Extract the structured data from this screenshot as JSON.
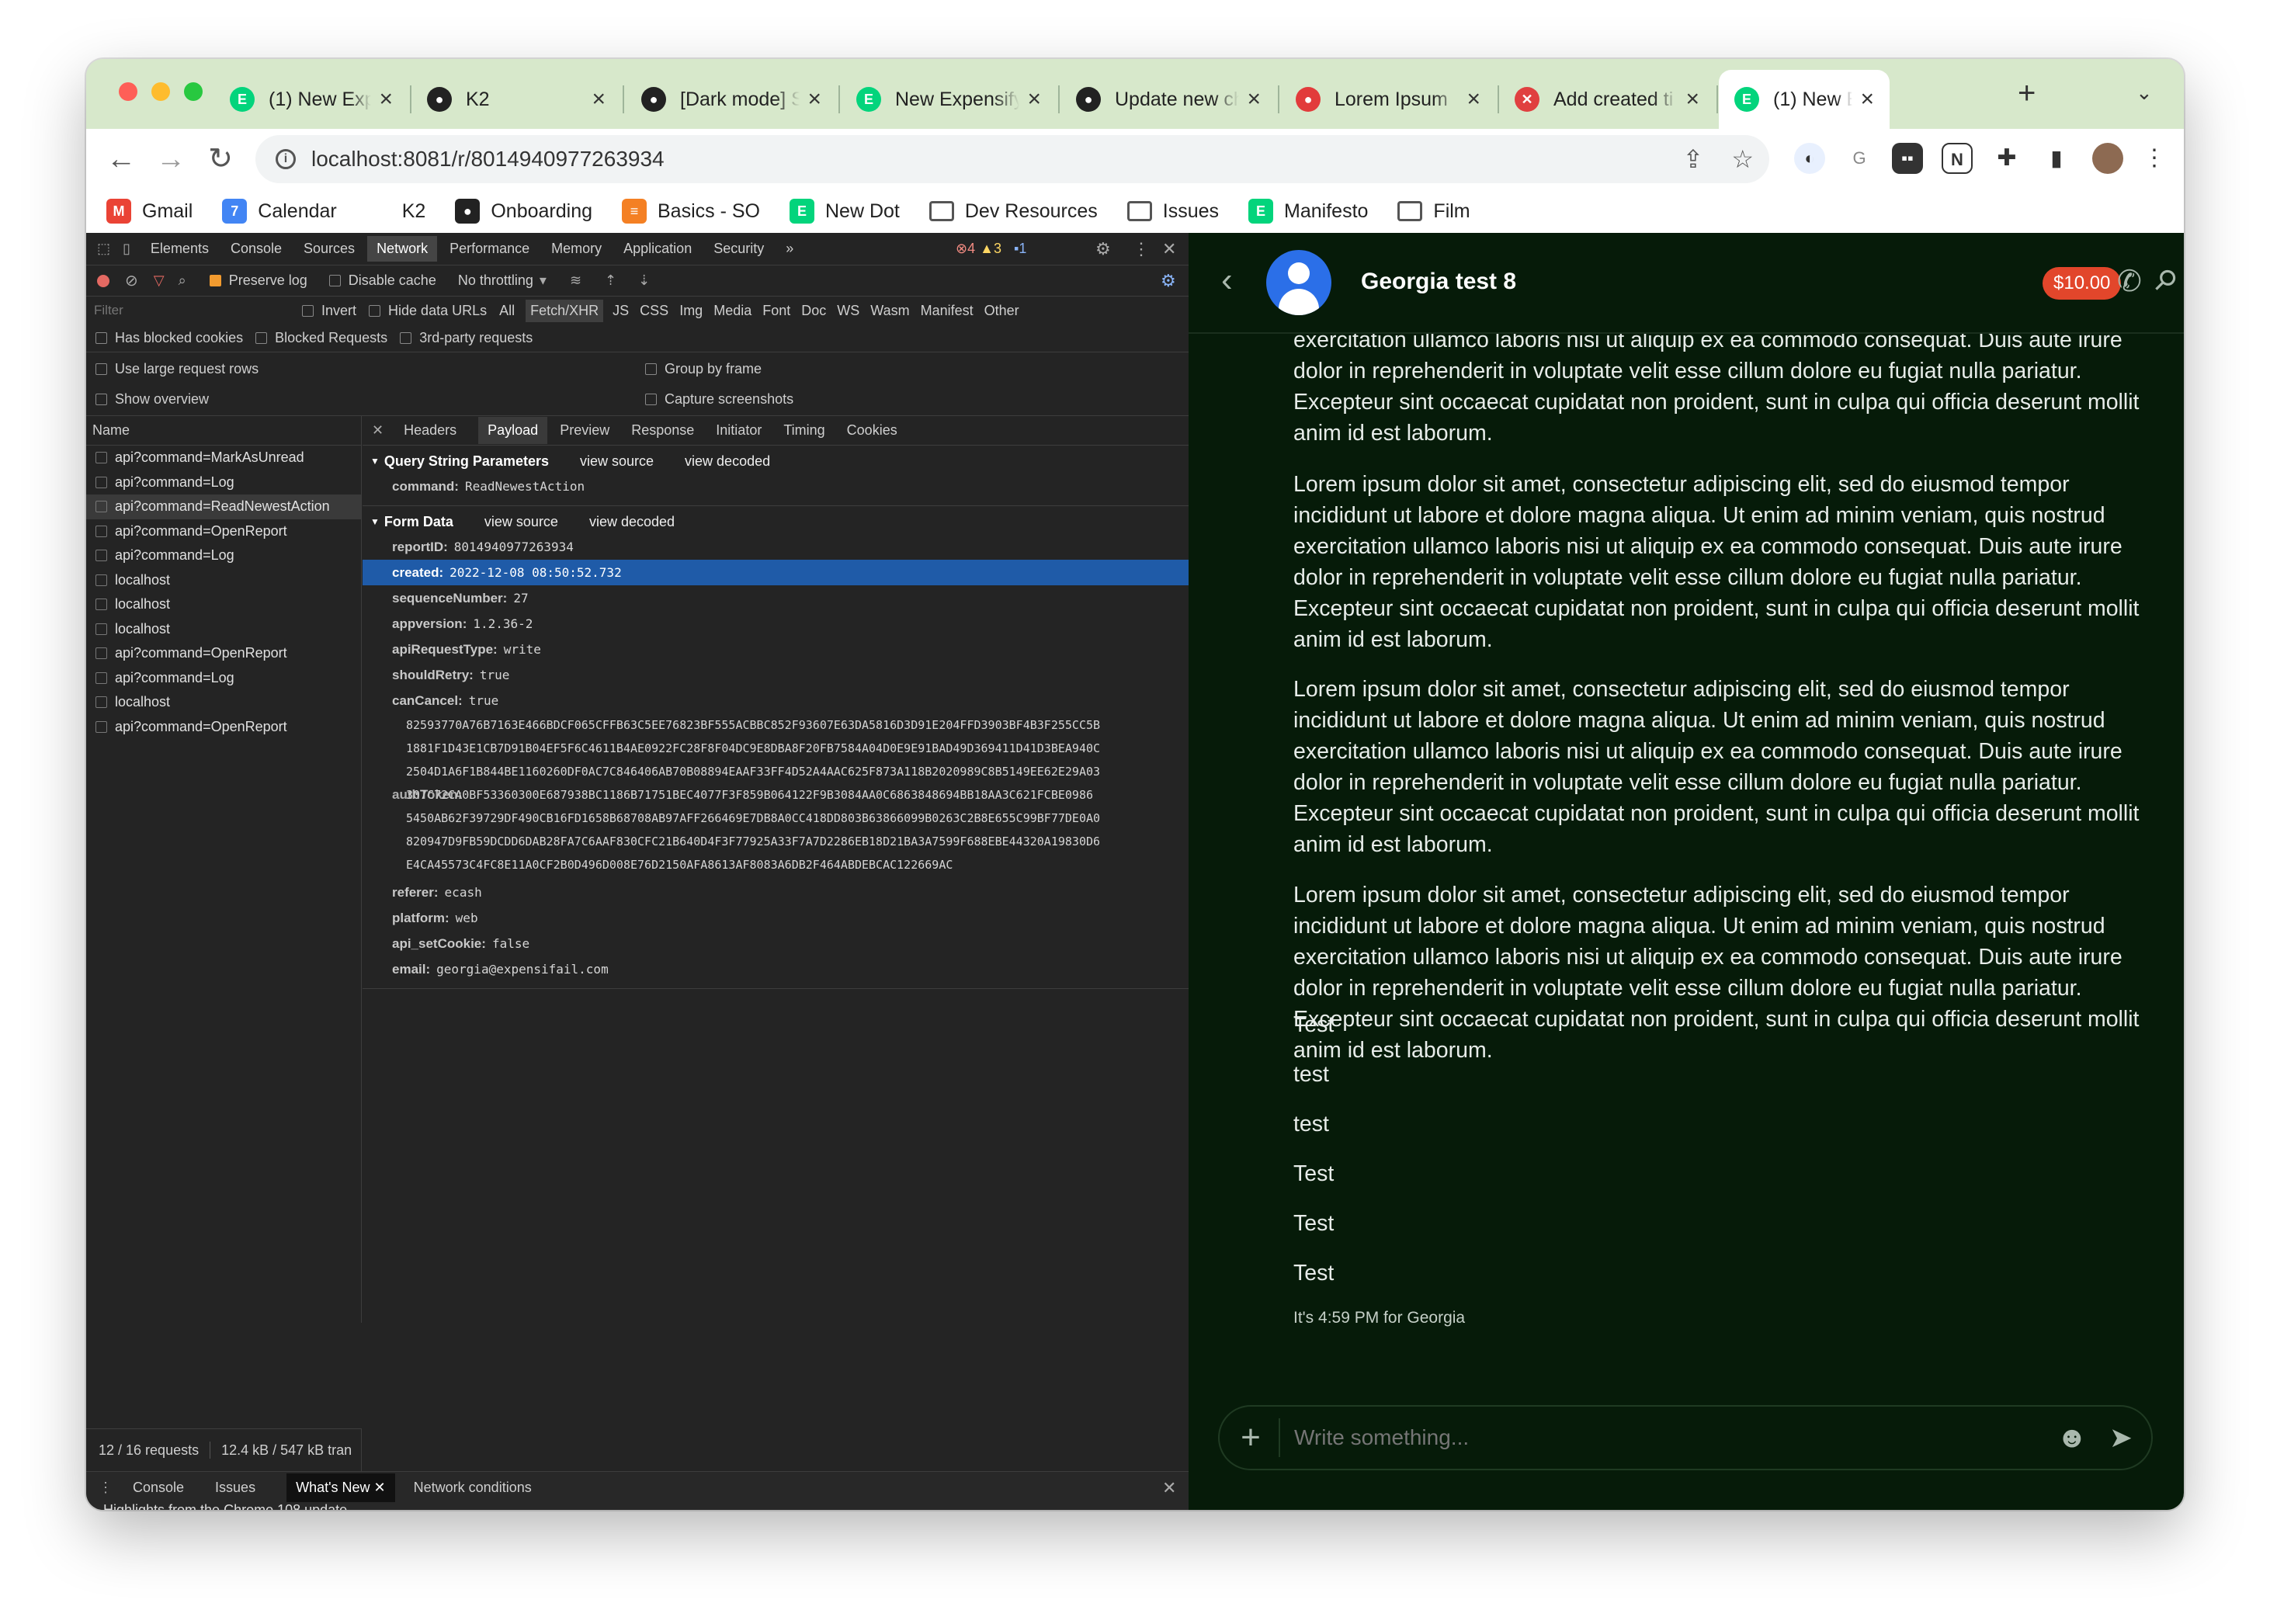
{
  "browser": {
    "tabs": [
      {
        "label": "(1) New Expensify",
        "icon": "expensify-icon",
        "color": "#03d47c"
      },
      {
        "label": "K2",
        "icon": "github-icon",
        "color": "#222222"
      },
      {
        "label": "[Dark mode] Se",
        "icon": "github-icon",
        "color": "#222222"
      },
      {
        "label": "New Expensify",
        "icon": "expensify-icon",
        "color": "#03d47c"
      },
      {
        "label": "Update new ch",
        "icon": "github-icon",
        "color": "#222222"
      },
      {
        "label": "Lorem Ipsum",
        "icon": "lorem-icon",
        "color": "#e23b3b"
      },
      {
        "label": "Add created ti",
        "icon": "error-icon",
        "color": "#e04040"
      },
      {
        "label": "(1) New Expensify",
        "icon": "expensify-icon",
        "color": "#03d47c"
      }
    ],
    "new_tab": "+",
    "url": "localhost:8081/r/8014940977263934",
    "bookmarks": [
      {
        "label": "Gmail",
        "icon": "gmail-icon"
      },
      {
        "label": "Calendar",
        "icon": "calendar-icon"
      },
      {
        "label": "K2",
        "icon": "blank-icon"
      },
      {
        "label": "Onboarding",
        "icon": "github-icon"
      },
      {
        "label": "Basics - SO",
        "icon": "stackoverflow-icon"
      },
      {
        "label": "New Dot",
        "icon": "expensify-icon"
      },
      {
        "label": "Dev Resources",
        "icon": "folder-icon"
      },
      {
        "label": "Issues",
        "icon": "folder-icon"
      },
      {
        "label": "Manifesto",
        "icon": "expensify-icon"
      },
      {
        "label": "Film",
        "icon": "folder-icon"
      }
    ]
  },
  "devtools": {
    "tabs": [
      "Elements",
      "Console",
      "Sources",
      "Network",
      "Performance",
      "Memory",
      "Application",
      "Security",
      "»"
    ],
    "active_tab": "Network",
    "badges": {
      "errors": "4",
      "warnings": "3",
      "messages": "1"
    },
    "toolbar": {
      "preserve_log": "Preserve log",
      "disable_cache": "Disable cache",
      "throttling": "No throttling"
    },
    "filter": {
      "placeholder": "Filter",
      "invert": "Invert",
      "hide_data_urls": "Hide data URLs",
      "types": [
        "All",
        "Fetch/XHR",
        "JS",
        "CSS",
        "Img",
        "Media",
        "Font",
        "Doc",
        "WS",
        "Wasm",
        "Manifest",
        "Other"
      ]
    },
    "options": {
      "blocked_cookies": "Has blocked cookies",
      "blocked_requests": "Blocked Requests",
      "third_party": "3rd-party requests",
      "large_rows": "Use large request rows",
      "group_by_frame": "Group by frame",
      "show_overview": "Show overview",
      "capture_screenshots": "Capture screenshots"
    },
    "name_header": "Name",
    "requests": [
      "api?command=MarkAsUnread",
      "api?command=Log",
      "api?command=ReadNewestAction",
      "api?command=OpenReport",
      "api?command=Log",
      "localhost",
      "localhost",
      "localhost",
      "api?command=OpenReport",
      "api?command=Log",
      "localhost",
      "api?command=OpenReport"
    ],
    "status_bar": {
      "requests": "12 / 16 requests",
      "transferred": "12.4 kB / 547 kB tran"
    },
    "payload_tabs": [
      "Headers",
      "Payload",
      "Preview",
      "Response",
      "Initiator",
      "Timing",
      "Cookies"
    ],
    "query_title": "Query String Parameters",
    "view_source": "view source",
    "view_decoded": "view decoded",
    "query_params": [
      {
        "k": "command:",
        "v": "ReadNewestAction"
      }
    ],
    "form_title": "Form Data",
    "form_data": [
      {
        "k": "reportID:",
        "v": "8014940977263934"
      },
      {
        "k": "created:",
        "v": "2022-12-08 08:50:52.732"
      },
      {
        "k": "sequenceNumber:",
        "v": "27"
      },
      {
        "k": "appversion:",
        "v": "1.2.36-2"
      },
      {
        "k": "apiRequestType:",
        "v": "write"
      },
      {
        "k": "shouldRetry:",
        "v": "true"
      },
      {
        "k": "canCancel:",
        "v": "true"
      }
    ],
    "auth_key": "authToken:",
    "hex_lines": [
      "82593770A76B7163E466BDCF065CFFB63C5EE76823BF555ACBBC852F93607E63DA5816D3D91E204FFD3903BF4B3F255CC5B",
      "1881F1D43E1CB7D91B04EF5F6C4611B4AE0922FC28F8F04DC9E8DBA8F20FB7584A04D0E9E91BAD49D369411D41D3BEA940C",
      "2504D1A6F1B844BE1160260DF0AC7C846406AB70B08894EAAF33FF4D52A4AAC625F873A118B2020989C8B5149EE62E29A03",
      "307C72CA0BF53360300E687938BC1186B71751BEC4077F3F859B064122F9B3084AA0C6863848694BB18AA3C621FCBE0986",
      "5450AB62F39729DF490CB16FD1658B68708AB97AFF266469E7DB8A0CC418DD803B63866099B0263C2B8E655C99BF77DE0A0",
      "820947D9FB59DCDD6DAB28FA7C6AAF830CFC21B640D4F3F77925A33F7A7D2286EB18D21BA3A7599F688EBE44320A19830D6",
      "E4CA45573C4FC8E11A0CF2B0D496D008E76D2150AFA8613AF8083A6DB2F464ABDEBCAC122669AC"
    ],
    "form_data_tail": [
      {
        "k": "referer:",
        "v": "ecash"
      },
      {
        "k": "platform:",
        "v": "web"
      },
      {
        "k": "api_setCookie:",
        "v": "false"
      },
      {
        "k": "email:",
        "v": "georgia@expensifail.com"
      }
    ],
    "drawer_tabs": [
      "Console",
      "Issues",
      "What's New",
      "Network conditions"
    ],
    "drawer_peek": "Highlights from the Chrome 108 update"
  },
  "chat": {
    "title": "Georgia test 8",
    "badge": "$10.00",
    "partial_message": "exercitation ullamco laboris nisi ut aliquip ex ea commodo consequat. Duis aute irure dolor in reprehenderit in voluptate velit esse cillum dolore eu fugiat nulla pariatur. Excepteur sint occaecat cupidatat non proident, sunt in culpa qui officia deserunt mollit anim id est laborum.",
    "lorem": "Lorem ipsum dolor sit amet, consectetur adipiscing elit, sed do eiusmod tempor incididunt ut labore et dolore magna aliqua. Ut enim ad minim veniam, quis nostrud exercitation ullamco laboris nisi ut aliquip ex ea commodo consequat. Duis aute irure dolor in reprehenderit in voluptate velit esse cillum dolore eu fugiat nulla pariatur. Excepteur sint occaecat cupidatat non proident, sunt in culpa qui officia deserunt mollit anim id est laborum.",
    "short_messages": [
      "Test",
      "test",
      "test",
      "Test",
      "Test",
      "Test"
    ],
    "local_time": "It's 4:59 PM for Georgia",
    "composer_placeholder": "Write something..."
  }
}
